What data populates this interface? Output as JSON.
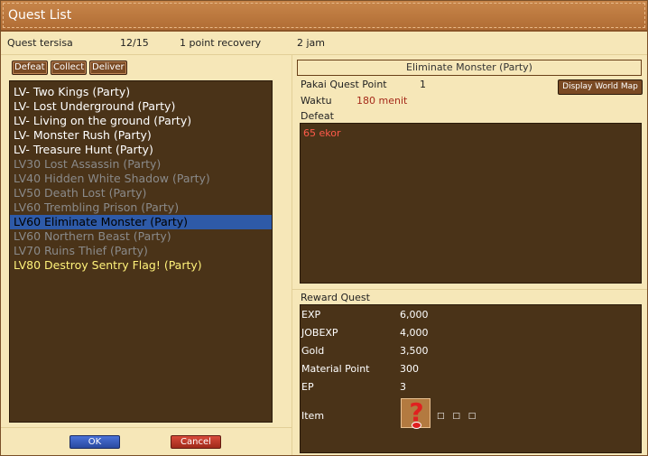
{
  "window": {
    "title": "Quest List"
  },
  "top_info": {
    "remaining_label": "Quest tersisa",
    "remaining_count": "12/15",
    "recovery": "1 point recovery",
    "time": "2 jam"
  },
  "filters": {
    "defeat": "Defeat",
    "collect": "Collect",
    "deliver": "Deliver"
  },
  "quests": [
    {
      "label": "LV- Two Kings (Party)",
      "style": "white"
    },
    {
      "label": "LV- Lost Underground (Party)",
      "style": "white"
    },
    {
      "label": "LV- Living on the ground (Party)",
      "style": "white"
    },
    {
      "label": "LV- Monster Rush (Party)",
      "style": "white"
    },
    {
      "label": "LV- Treasure Hunt (Party)",
      "style": "white"
    },
    {
      "label": "LV30 Lost Assassin (Party)",
      "style": "gray"
    },
    {
      "label": "LV40 Hidden White Shadow (Party)",
      "style": "gray"
    },
    {
      "label": "LV50 Death Lost (Party)",
      "style": "gray"
    },
    {
      "label": "LV60 Trembling Prison (Party)",
      "style": "gray"
    },
    {
      "label": "LV60 Eliminate Monster (Party)",
      "style": "selected"
    },
    {
      "label": "LV60 Northern Beast (Party)",
      "style": "gray"
    },
    {
      "label": "LV70 Ruins Thief (Party)",
      "style": "gray"
    },
    {
      "label": "LV80 Destroy Sentry Flag! (Party)",
      "style": "yellow"
    }
  ],
  "detail": {
    "title": "Eliminate Monster (Party)",
    "quest_point_label": "Pakai Quest Point",
    "quest_point_value": "1",
    "time_label": "Waktu",
    "time_value": "180 menit",
    "map_button": "Display World Map",
    "objective_label": "Defeat",
    "objective_text": "65 ekor"
  },
  "reward": {
    "label": "Reward Quest",
    "rows": [
      {
        "key": "EXP",
        "value": "6,000"
      },
      {
        "key": "JOBEXP",
        "value": "4,000"
      },
      {
        "key": "Gold",
        "value": "3,500"
      },
      {
        "key": "Material Point",
        "value": "300"
      },
      {
        "key": "EP",
        "value": "3"
      }
    ],
    "item_label": "Item",
    "item_icon": "unknown-item-icon",
    "item_placeholder": "□ □ □"
  },
  "buttons": {
    "ok": "OK",
    "cancel": "Cancel"
  },
  "colors": {
    "panel_bg": "#4a3318",
    "window_bg": "#f6e7b8",
    "title_bg": "#b06c34",
    "selected_row": "#2e5aa8",
    "highlight_yellow": "#fff27a",
    "objective_red": "#ff5a4a"
  }
}
